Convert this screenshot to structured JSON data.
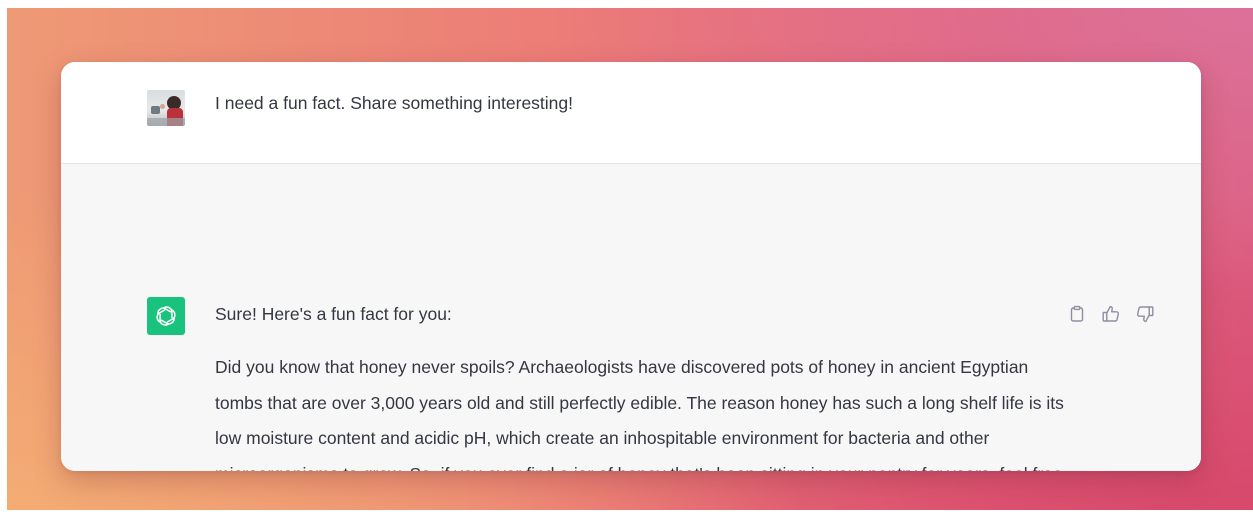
{
  "conversation": {
    "user_message": {
      "avatar": "user-avatar-photo",
      "text": "I need a fun fact. Share something interesting!"
    },
    "assistant_message": {
      "avatar": "openai-logo-icon",
      "intro": "Sure! Here's a fun fact for you:",
      "body": "Did you know that honey never spoils? Archaeologists have discovered pots of honey in ancient Egyptian tombs that are over 3,000 years old and still perfectly edible. The reason honey has such a long shelf life is its low moisture content and acidic pH, which create an inhospitable environment for bacteria and other microorganisms to grow. So, if you ever find a jar of honey that's been sitting in your pantry for years, feel free to enjoy it without worry!",
      "actions": [
        "clipboard-icon",
        "thumbs-up-icon",
        "thumbs-down-icon"
      ]
    }
  },
  "colors": {
    "assistant_avatar_bg": "#19c37d",
    "text": "#353740",
    "user_row_bg": "#ffffff",
    "assistant_row_bg": "#f7f7f8"
  }
}
